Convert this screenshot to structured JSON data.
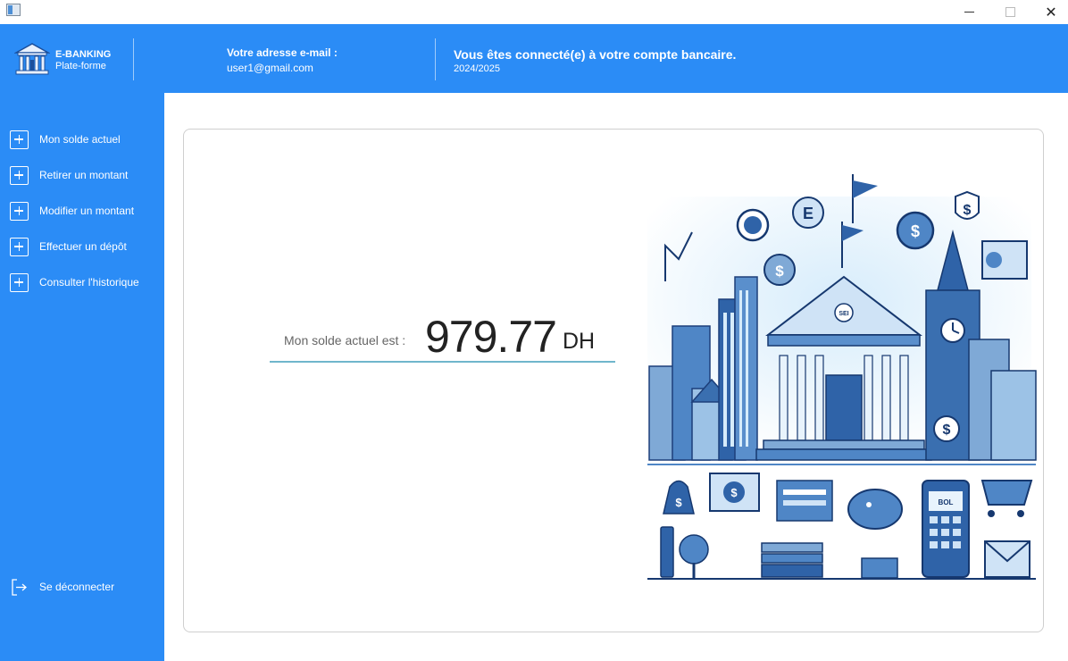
{
  "window": {
    "close_glyph": "✕"
  },
  "header": {
    "brand_title": "E-BANKING",
    "brand_subtitle": "Plate-forme",
    "email_label": "Votre adresse e-mail :",
    "email_value": "user1@gmail.com",
    "connected_message": "Vous êtes connecté(e) à votre compte bancaire.",
    "year": "2024/2025",
    "color": "#2b8cf6"
  },
  "sidebar": {
    "items": [
      {
        "label": "Mon solde actuel",
        "icon": "plus-square-icon"
      },
      {
        "label": "Retirer un montant",
        "icon": "plus-square-icon"
      },
      {
        "label": "Modifier un montant",
        "icon": "plus-square-icon"
      },
      {
        "label": "Effectuer un dépôt",
        "icon": "plus-square-icon"
      },
      {
        "label": "Consulter l'historique",
        "icon": "plus-square-icon"
      }
    ],
    "logout_label": "Se déconnecter",
    "logout_icon": "logout-icon"
  },
  "main": {
    "balance_label": "Mon solde actuel est :",
    "balance_value": "979.77",
    "balance_currency": "DH",
    "illustration_texts": {
      "bank_pediment": "SEI",
      "clock_badge": "E",
      "phone_screen": "BOL"
    }
  }
}
